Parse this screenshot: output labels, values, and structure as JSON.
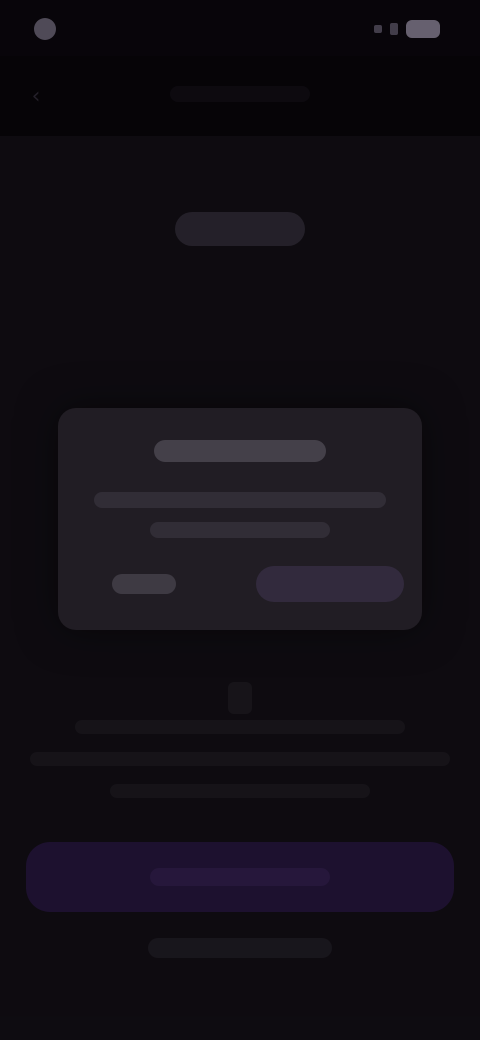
{
  "status_bar": {
    "icons": [
      "camera-icon",
      "signal-icon",
      "battery-icon"
    ]
  },
  "header": {
    "back_icon": "chevron-left-icon"
  },
  "dialog": {
    "title": "",
    "body": "",
    "cancel_label": "",
    "confirm_label": ""
  },
  "main": {
    "headline": "",
    "primary_cta_label": "",
    "secondary_link_label": ""
  },
  "colors": {
    "background": "#0f0d12",
    "dialog_background": "#26232a",
    "accent": "#221438"
  }
}
